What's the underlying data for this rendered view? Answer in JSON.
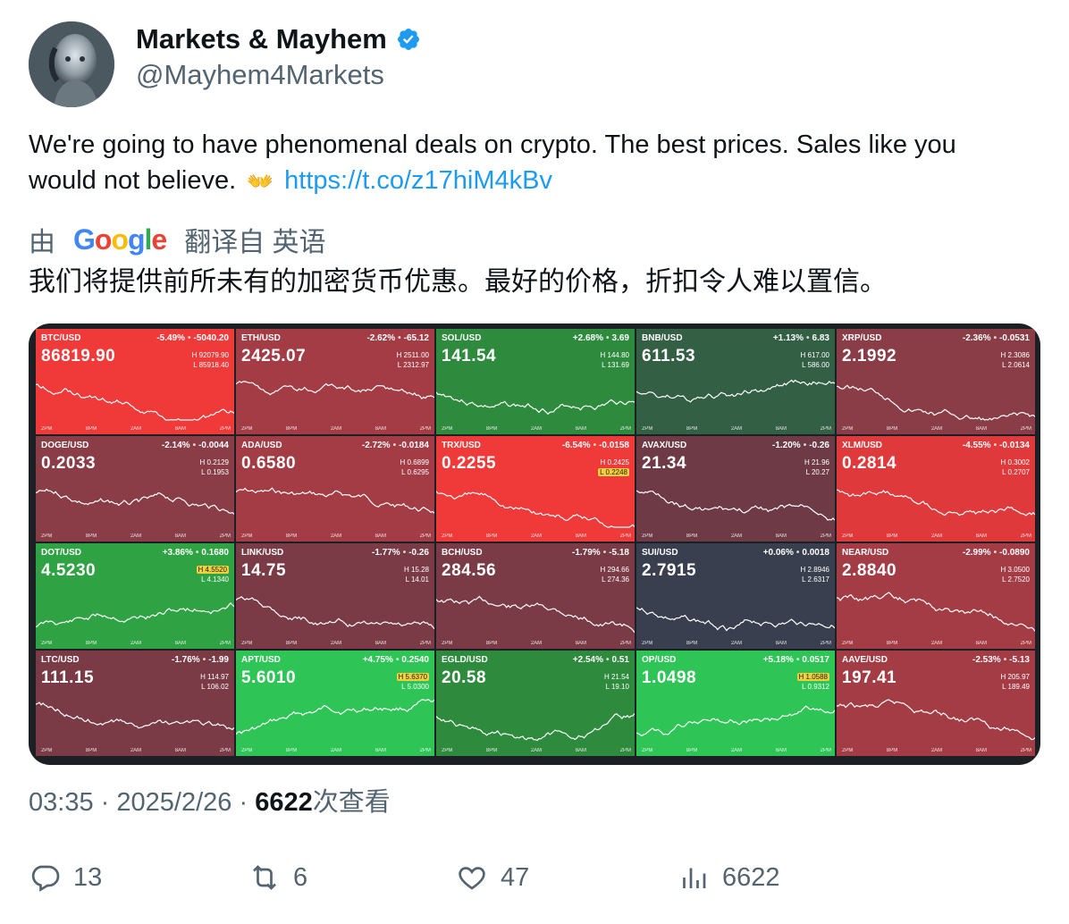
{
  "author": {
    "display_name": "Markets & Mayhem",
    "handle": "@Mayhem4Markets",
    "verified_icon": "verified-badge-icon"
  },
  "tweet": {
    "text": "We're going to have phenomenal deals on crypto. The best prices. Sales like you would not believe.",
    "emoji": "👐",
    "link": "https://t.co/z17hiM4kBv"
  },
  "translation": {
    "prefix": "由",
    "provider": "Google",
    "suffix": "翻译自 英语",
    "text": "我们将提供前所未有的加密货币优惠。最好的价格，折扣令人难以置信。"
  },
  "colors": {
    "deep_red": "#f03a3a",
    "muted_red": "#8a3d47",
    "red": "#b23a44",
    "green": "#2e8b3e",
    "dark_green": "#335f44",
    "bright_green": "#2fc556",
    "slate": "#3a3f4f",
    "link": "#1d9bf0",
    "secondary_text": "#536471"
  },
  "heatmap": {
    "time_labels": [
      "2PM",
      "8PM",
      "2AM",
      "8AM",
      "2PM"
    ],
    "tiles": [
      {
        "symbol": "BTC/USD",
        "pct": "-5.49%",
        "abs": "-5040.20",
        "price": "86819.90",
        "high": "92079.90",
        "low": "85918.40",
        "color": "#f03a3a",
        "trend": -1
      },
      {
        "symbol": "ETH/USD",
        "pct": "-2.62%",
        "abs": "-65.12",
        "price": "2425.07",
        "high": "2511.00",
        "low": "2312.97",
        "color": "#a43c45",
        "trend": -1
      },
      {
        "symbol": "SOL/USD",
        "pct": "+2.68%",
        "abs": "3.69",
        "price": "141.54",
        "high": "144.80",
        "low": "131.69",
        "color": "#2e8b3e",
        "trend": 0
      },
      {
        "symbol": "BNB/USD",
        "pct": "+1.13%",
        "abs": "6.83",
        "price": "611.53",
        "high": "617.00",
        "low": "586.00",
        "color": "#335f44",
        "trend": 0
      },
      {
        "symbol": "XRP/USD",
        "pct": "-2.36%",
        "abs": "-0.0531",
        "price": "2.1992",
        "high": "2.3086",
        "low": "2.0614",
        "color": "#8a3d47",
        "trend": -1
      },
      {
        "symbol": "DOGE/USD",
        "pct": "-2.14%",
        "abs": "-0.0044",
        "price": "0.2033",
        "high": "0.2129",
        "low": "0.1953",
        "color": "#8a3d47",
        "trend": -1
      },
      {
        "symbol": "ADA/USD",
        "pct": "-2.72%",
        "abs": "-0.0184",
        "price": "0.6580",
        "high": "0.6899",
        "low": "0.6295",
        "color": "#a43c45",
        "trend": -1
      },
      {
        "symbol": "TRX/USD",
        "pct": "-6.54%",
        "abs": "-0.0158",
        "price": "0.2255",
        "high": "0.2425",
        "low": "0.2248",
        "color": "#f03a3a",
        "trend": -1,
        "low_badge": true
      },
      {
        "symbol": "AVAX/USD",
        "pct": "-1.20%",
        "abs": "-0.26",
        "price": "21.34",
        "high": "21.96",
        "low": "20.27",
        "color": "#6e3a46",
        "trend": -1
      },
      {
        "symbol": "XLM/USD",
        "pct": "-4.55%",
        "abs": "-0.0134",
        "price": "0.2814",
        "high": "0.3002",
        "low": "0.2707",
        "color": "#e0393b",
        "trend": -1
      },
      {
        "symbol": "DOT/USD",
        "pct": "+3.86%",
        "abs": "0.1680",
        "price": "4.5230",
        "high": "4.5520",
        "low": "4.1340",
        "color": "#2fa344",
        "trend": 1,
        "high_badge": true
      },
      {
        "symbol": "LINK/USD",
        "pct": "-1.77%",
        "abs": "-0.26",
        "price": "14.75",
        "high": "15.28",
        "low": "14.01",
        "color": "#7a3b46",
        "trend": -1
      },
      {
        "symbol": "BCH/USD",
        "pct": "-1.79%",
        "abs": "-5.18",
        "price": "284.56",
        "high": "294.66",
        "low": "274.36",
        "color": "#7a3b46",
        "trend": -1
      },
      {
        "symbol": "SUI/USD",
        "pct": "+0.06%",
        "abs": "0.0018",
        "price": "2.7915",
        "high": "2.8946",
        "low": "2.6317",
        "color": "#3a3f4f",
        "trend": 0
      },
      {
        "symbol": "NEAR/USD",
        "pct": "-2.99%",
        "abs": "-0.0890",
        "price": "2.8840",
        "high": "3.0500",
        "low": "2.7520",
        "color": "#a43c45",
        "trend": -1
      },
      {
        "symbol": "LTC/USD",
        "pct": "-1.76%",
        "abs": "-1.99",
        "price": "111.15",
        "high": "114.97",
        "low": "106.02",
        "color": "#7a3b46",
        "trend": -1
      },
      {
        "symbol": "APT/USD",
        "pct": "+4.75%",
        "abs": "0.2540",
        "price": "5.6010",
        "high": "5.6370",
        "low": "5.0300",
        "color": "#2fc556",
        "trend": 1,
        "high_badge": true
      },
      {
        "symbol": "EGLD/USD",
        "pct": "+2.54%",
        "abs": "0.51",
        "price": "20.58",
        "high": "21.54",
        "low": "19.10",
        "color": "#2e8b3e",
        "trend": 0
      },
      {
        "symbol": "OP/USD",
        "pct": "+5.18%",
        "abs": "0.0517",
        "price": "1.0498",
        "high": "1.0588",
        "low": "0.9312",
        "color": "#2fc556",
        "trend": 1,
        "high_badge": true
      },
      {
        "symbol": "AAVE/USD",
        "pct": "-2.53%",
        "abs": "-5.13",
        "price": "197.41",
        "high": "205.97",
        "low": "189.49",
        "color": "#a43c45",
        "trend": -1
      }
    ]
  },
  "meta": {
    "time": "03:35",
    "sep": "·",
    "date": "2025/2/26",
    "views_count": "6622",
    "views_label": "次查看"
  },
  "actions": {
    "replies": "13",
    "retweets": "6",
    "likes": "47",
    "views": "6622"
  }
}
